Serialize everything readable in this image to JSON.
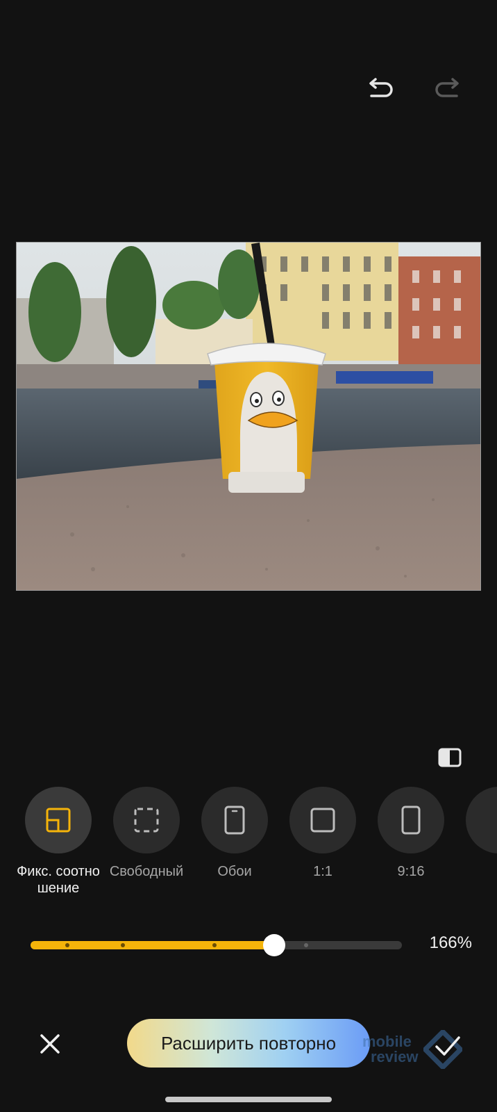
{
  "toolbar": {
    "undo_icon": "undo-icon",
    "redo_icon": "redo-icon"
  },
  "image": {
    "description_icon": "photo"
  },
  "compare_icon": "compare-icon",
  "ratios": [
    {
      "label": "Фикс. соотношение",
      "icon": "fixed-ratio-icon",
      "active": true
    },
    {
      "label": "Свободный",
      "icon": "free-crop-icon",
      "active": false
    },
    {
      "label": "Обои",
      "icon": "wallpaper-icon",
      "active": false
    },
    {
      "label": "1:1",
      "icon": "square-icon",
      "active": false
    },
    {
      "label": "9:16",
      "icon": "portrait-icon",
      "active": false
    }
  ],
  "zoom": {
    "value_text": "166%",
    "fraction": 0.657
  },
  "bottom": {
    "close_icon": "close-icon",
    "expand_label": "Расширить повторно",
    "confirm_icon": "check-icon"
  },
  "watermark": {
    "line1": "mobile",
    "line2": "review"
  },
  "colors": {
    "accent": "#f5b40a",
    "background": "#121212"
  }
}
